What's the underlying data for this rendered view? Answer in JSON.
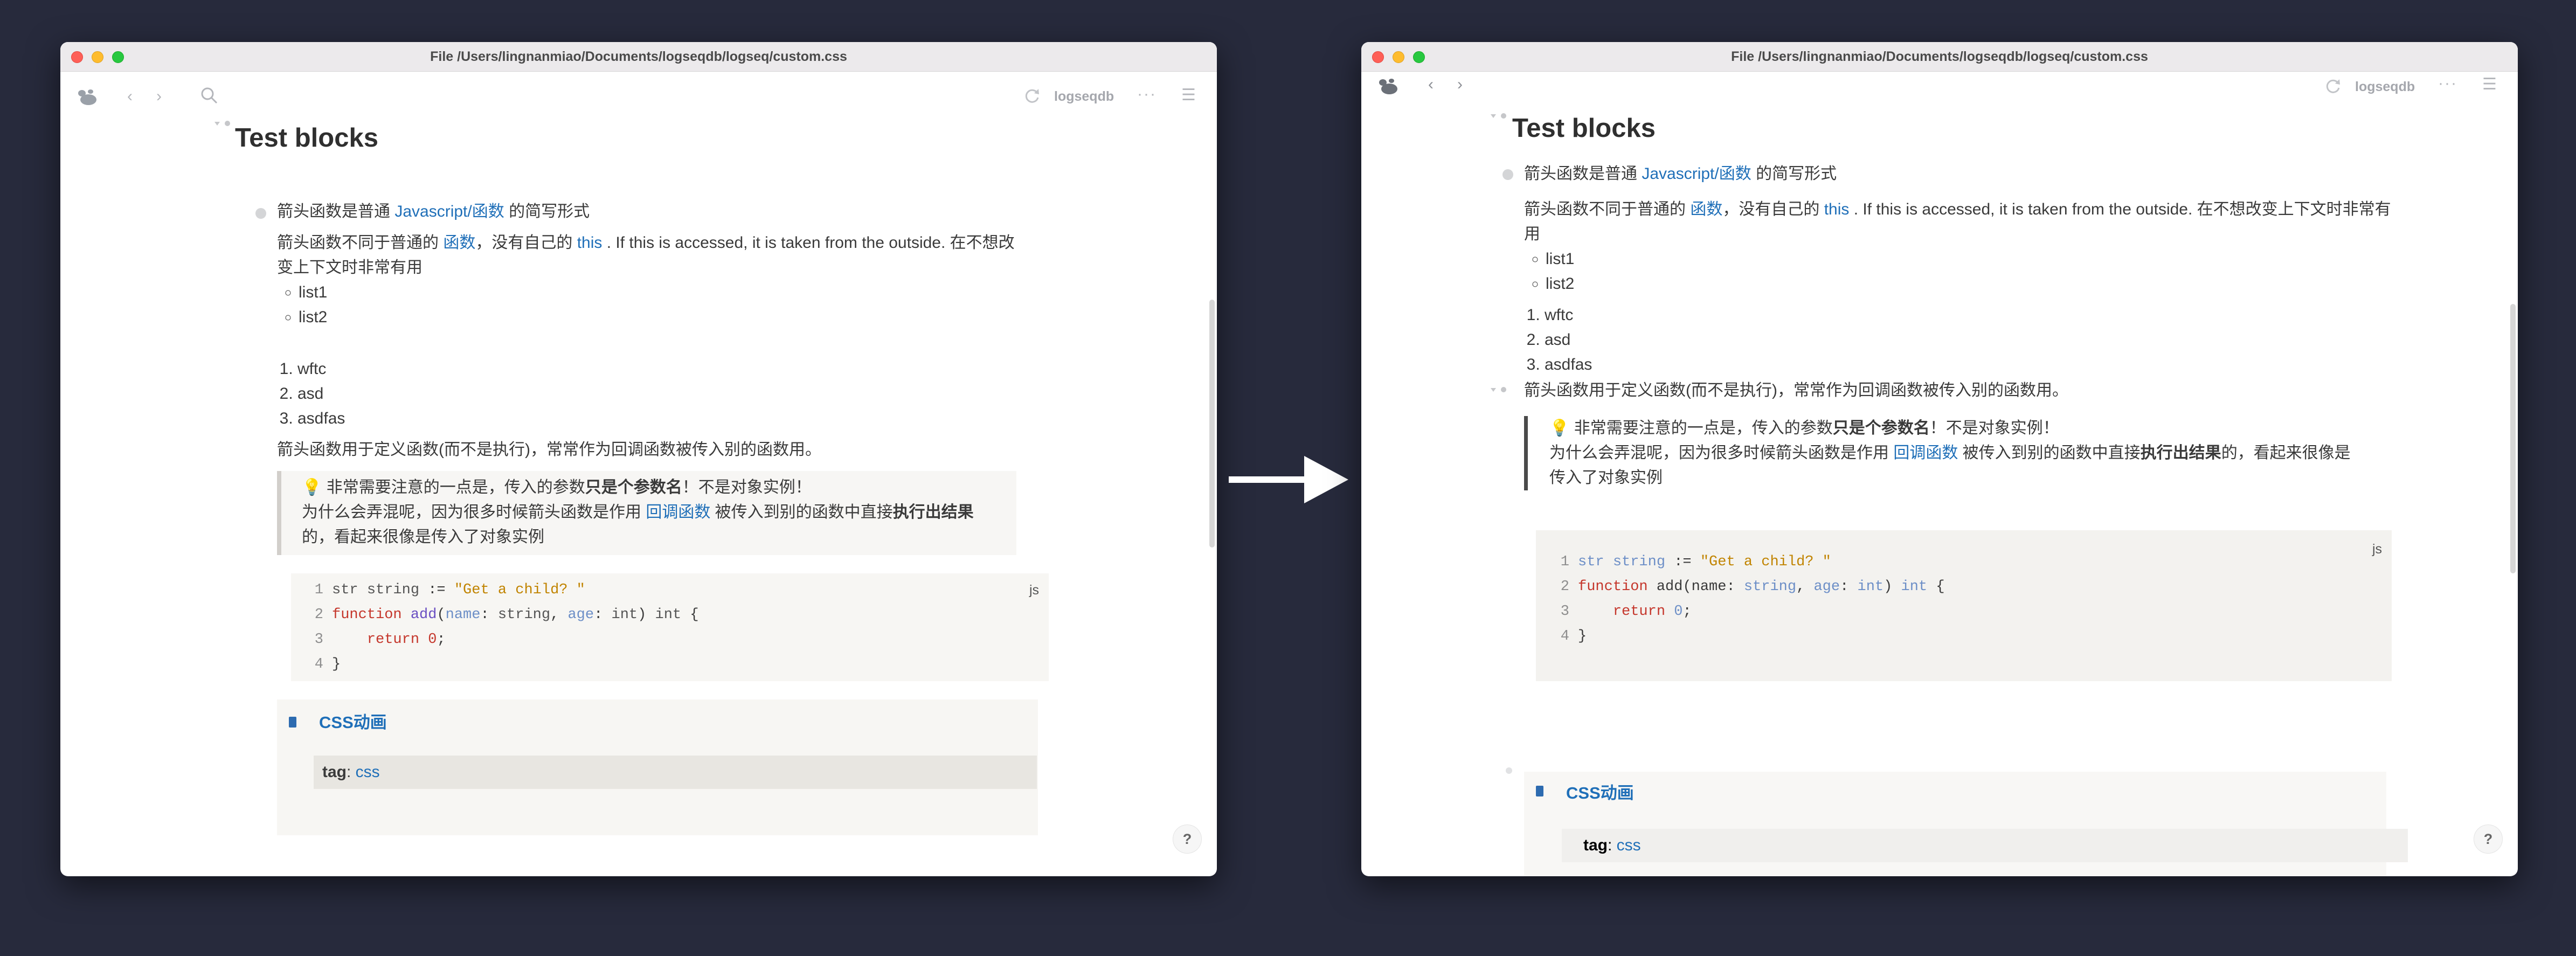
{
  "window": {
    "title": "File /Users/lingnanmiao/Documents/logseqdb/logseq/custom.css"
  },
  "toolbar": {
    "logo_icon": "logseq-logo-icon",
    "back_icon": "chevron-left-icon",
    "forward_icon": "chevron-right-icon",
    "search_icon": "search-icon",
    "sync_icon": "sync-icon",
    "repo_name": "logseqdb",
    "more_icon": "more-dots-icon",
    "sidebar_icon": "sidebar-menu-icon"
  },
  "help_button": {
    "label": "?"
  },
  "page": {
    "title": "Test blocks",
    "block1_prefix": "箭头函数是普通 ",
    "block1_link": "Javascript/函数",
    "block1_suffix": " 的简写形式",
    "desc_part1": "箭头函数不同于普通的 ",
    "desc_link1": "函数",
    "desc_part2": "，没有自己的 ",
    "desc_link2": "this",
    "desc_part3": " . If this is accessed, it is taken from the outside. 在不想改变上下文时非常有用",
    "list_unordered": [
      "list1",
      "list2"
    ],
    "list_ordered": [
      "wftc",
      "asd",
      "asdfas"
    ],
    "block2": "箭头函数用于定义函数(而不是执行)，常常作为回调函数被传入别的函数用。",
    "quote_line1_prefix": "💡 非常需要注意的一点是，传入的参数",
    "quote_line1_bold": "只是个参数名",
    "quote_line1_suffix": "！不是对象实例！",
    "quote_line2_prefix": "为什么会弄混呢，因为很多时候箭头函数是作用 ",
    "quote_line2_link": "回调函数",
    "quote_line2_mid": " 被传入到别的函数中直接",
    "quote_line2_bold": "执行出结果",
    "quote_line2_suffix": "的，看起来很像是传入了对象实例",
    "code_lang": "js",
    "code": {
      "line_numbers": [
        "1",
        "2",
        "3",
        "4"
      ],
      "l1_a": "str ",
      "l1_b": "string",
      "l1_c": " := ",
      "l1_d": "\"Get a child? \"",
      "l2_a": "function ",
      "l2_b": "add",
      "l2_c": "(",
      "l2_d": "name",
      "l2_e": ": ",
      "l2_f": "string",
      "l2_g": ", ",
      "l2_h": "age",
      "l2_i": ": ",
      "l2_j": "int",
      "l2_k": ") ",
      "l2_l": "int",
      "l2_m": " {",
      "l3_a": "return ",
      "l3_b": "0",
      "l3_c": ";",
      "l4": "}"
    },
    "embed_title": "CSS动画",
    "embed_icon": "page-icon",
    "tag_label": "tag",
    "tag_sep": ": ",
    "tag_value": "css"
  },
  "arrow_icon": "right-arrow-icon"
}
